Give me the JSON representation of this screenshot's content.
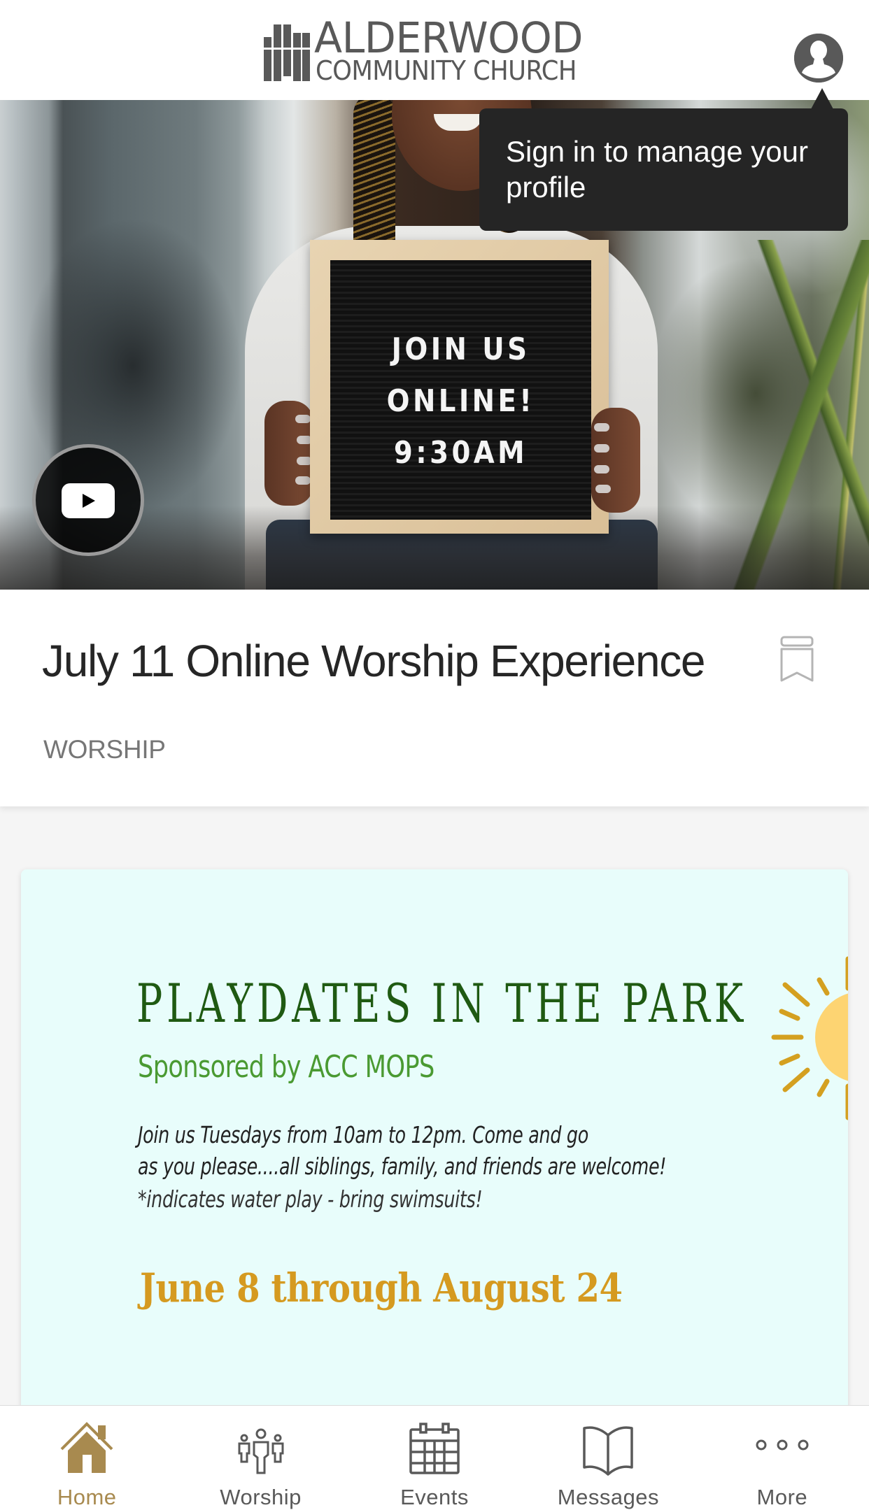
{
  "header": {
    "logo_name": "ALDERWOOD",
    "logo_subtitle": "COMMUNITY CHURCH",
    "profile_icon": "user-avatar-icon"
  },
  "tooltip": {
    "text": "Sign in to manage your profile"
  },
  "hero": {
    "sign_lines": [
      "JOIN US",
      "ONLINE!",
      "9:30AM"
    ],
    "video_icon": "youtube-play-icon"
  },
  "featured": {
    "title": "July 11 Online Worship Experience",
    "category": "WORSHIP",
    "bookmark_icon": "bookmark-icon"
  },
  "promo": {
    "title": "PLAYDATES IN THE PARK",
    "sponsor": "Sponsored by ACC MOPS",
    "body_lines": [
      "Join us Tuesdays from 10am to 12pm. Come and go",
      "as you please....all siblings, family, and friends are welcome!",
      "*indicates water play - bring swimsuits!"
    ],
    "dates": "June 8 through August 24"
  },
  "tabbar": {
    "active_color": "#a88a4f",
    "inactive_color": "#595959",
    "tabs": [
      {
        "label": "Home",
        "icon": "home-icon",
        "active": true
      },
      {
        "label": "Worship",
        "icon": "people-icon",
        "active": false
      },
      {
        "label": "Events",
        "icon": "calendar-icon",
        "active": false
      },
      {
        "label": "Messages",
        "icon": "book-icon",
        "active": false
      },
      {
        "label": "More",
        "icon": "more-icon",
        "active": false
      }
    ]
  },
  "colors": {
    "tooltip_bg": "#252525",
    "promo_bg": "#e8fdfb",
    "promo_title": "#1f5a12",
    "promo_sponsor": "#4a9a32",
    "promo_dates": "#d59a20",
    "page_bg": "#f5f5f5"
  }
}
